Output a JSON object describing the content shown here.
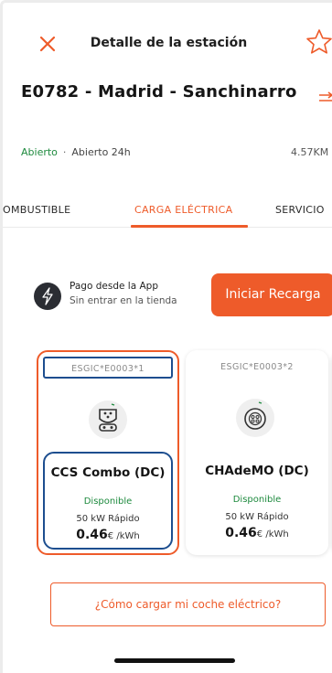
{
  "colors": {
    "accent": "#ee5b2a",
    "available": "#1e8a3e",
    "highlight_outline": "#1d4e8f"
  },
  "header": {
    "title": "Detalle de la estación",
    "close_icon": "close-icon",
    "favorite_icon": "star-outline-icon"
  },
  "station": {
    "name": "E0782 - Madrid - Sanchinarro",
    "status": "Abierto",
    "hours": "Abierto 24h",
    "distance": "4.57KM",
    "directions_icon": "route-arrow-icon"
  },
  "tabs": [
    {
      "label": "OMBUSTIBLE"
    },
    {
      "label": "CARGA ELÉCTRICA",
      "active": true
    },
    {
      "label": "SERVICIO"
    }
  ],
  "payment": {
    "title": "Pago desde la App",
    "subtitle": "Sin entrar en la tienda",
    "icon": "lightning-icon",
    "start_button": "Iniciar Recarga"
  },
  "connectors": [
    {
      "id": "ESGIC*E0003*1",
      "name": "CCS Combo (DC)",
      "status": "Disponible",
      "power": "50 kW  Rápido",
      "price": "0.46",
      "unit": "€ /kWh",
      "icon": "ccs-connector-icon",
      "selected": true
    },
    {
      "id": "ESGIC*E0003*2",
      "name": "CHAdeMO (DC)",
      "status": "Disponible",
      "power": "50 kW  Rápido",
      "price": "0.46",
      "unit": "€ /kWh",
      "icon": "chademo-connector-icon",
      "selected": false
    }
  ],
  "help_button": "¿Cómo cargar mi coche eléctrico?"
}
